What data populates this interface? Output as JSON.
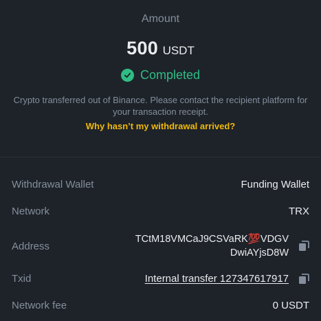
{
  "amount": {
    "label": "Amount",
    "value": "500",
    "unit": "USDT"
  },
  "status": {
    "text": "Completed",
    "icon": "check-circle-icon",
    "color": "#2ebd85"
  },
  "notice": "Crypto transferred out of Binance. Please contact the recipient platform for your transaction receipt.",
  "help_link": "Why hasn’t my withdrawal arrived?",
  "details": {
    "withdrawal_wallet": {
      "label": "Withdrawal Wallet",
      "value": "Funding Wallet"
    },
    "network": {
      "label": "Network",
      "value": "TRX"
    },
    "address": {
      "label": "Address",
      "line1": "TCtM18VMCaJ9CSVaRK💯VDGV",
      "line2": "DwiAYjsD8W"
    },
    "txid": {
      "label": "Txid",
      "value": "Internal transfer 127347617917"
    },
    "network_fee": {
      "label": "Network fee",
      "value": "0 USDT"
    }
  },
  "colors": {
    "background": "#1e2329",
    "accent_yellow": "#f0b90b",
    "muted_text": "#848e9c"
  }
}
